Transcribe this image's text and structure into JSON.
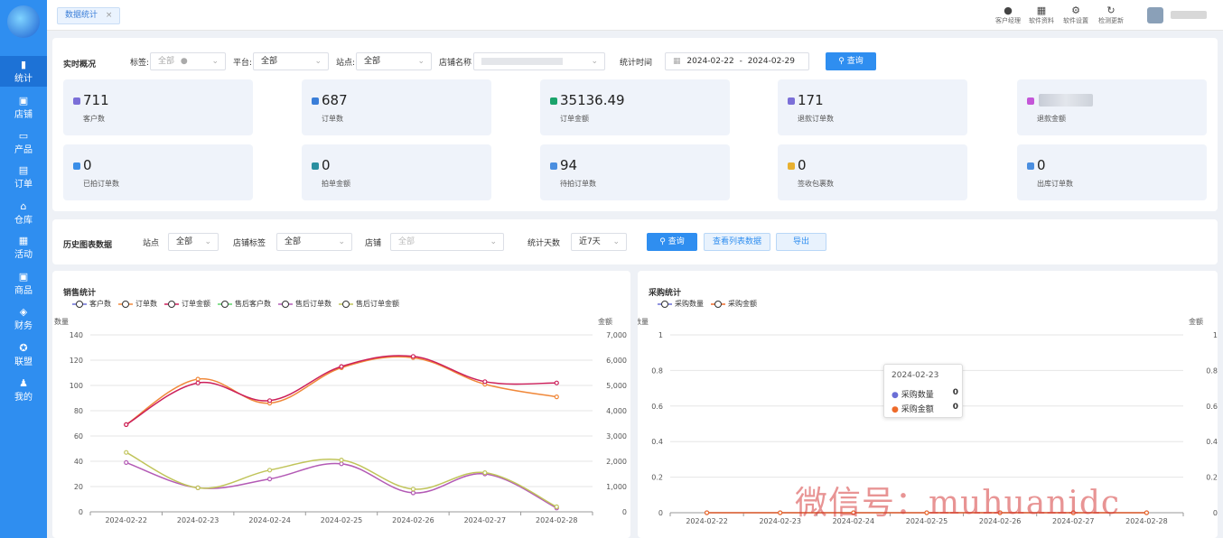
{
  "nav": [
    {
      "label": "统计",
      "icon": "bar-chart-icon",
      "active": true
    },
    {
      "label": "店铺",
      "icon": "store-icon"
    },
    {
      "label": "产品",
      "icon": "product-icon"
    },
    {
      "label": "订单",
      "icon": "order-icon"
    },
    {
      "label": "仓库",
      "icon": "warehouse-icon"
    },
    {
      "label": "活动",
      "icon": "gift-icon"
    },
    {
      "label": "商品",
      "icon": "goods-icon"
    },
    {
      "label": "财务",
      "icon": "finance-icon"
    },
    {
      "label": "联盟",
      "icon": "alliance-icon"
    },
    {
      "label": "我的",
      "icon": "user-icon"
    }
  ],
  "tab": {
    "label": "数据统计",
    "close": "×"
  },
  "topbar": {
    "buttons": [
      {
        "label": "客户经理",
        "icon": "manager-icon"
      },
      {
        "label": "软件资料",
        "icon": "docs-icon"
      },
      {
        "label": "软件设置",
        "icon": "gear-icon"
      },
      {
        "label": "检测更新",
        "icon": "refresh-icon"
      }
    ]
  },
  "realtime": {
    "title": "实时概况",
    "tag_label": "标签:",
    "tag_value": "全部",
    "platform_label": "平台:",
    "platform_value": "全部",
    "site_label": "站点:",
    "site_value": "全部",
    "shop_label": "店铺名称",
    "time_label": "统计时间",
    "date_start": "2024-02-22",
    "date_sep": "-",
    "date_end": "2024-02-29",
    "query": "查询"
  },
  "cards": [
    {
      "value": "711",
      "label": "客户数",
      "color": "#7b6fd8"
    },
    {
      "value": "687",
      "label": "订单数",
      "color": "#3a7ed8"
    },
    {
      "value": "35136.49",
      "label": "订单金额",
      "color": "#1aa36b"
    },
    {
      "value": "171",
      "label": "退款订单数",
      "color": "#7b6fd8"
    },
    {
      "value": "",
      "label": "退款金额",
      "color": "#c456d8"
    },
    {
      "value": "0",
      "label": "已拍订单数",
      "color": "#3a8ee8"
    },
    {
      "value": "0",
      "label": "拍单金额",
      "color": "#2a8fa0"
    },
    {
      "value": "94",
      "label": "待拍订单数",
      "color": "#4a8ee0"
    },
    {
      "value": "0",
      "label": "签收包裹数",
      "color": "#e8b030"
    },
    {
      "value": "0",
      "label": "出库订单数",
      "color": "#4a8ee0"
    }
  ],
  "history": {
    "title": "历史图表数据",
    "site_label": "站点",
    "site_value": "全部",
    "shoptag_label": "店铺标签",
    "shoptag_value": "全部",
    "shop_label": "店铺",
    "shop_value": "全部",
    "days_label": "统计天数",
    "days_value": "近7天",
    "query": "查询",
    "view_list": "查看列表数据",
    "export": "导出"
  },
  "chart_data": [
    {
      "type": "line",
      "title": "销售统计",
      "ylabel": "数量",
      "y2label": "金额",
      "ylim": [
        0,
        140
      ],
      "y2lim": [
        0,
        7000
      ],
      "yticks": [
        "0",
        "20",
        "40",
        "60",
        "80",
        "100",
        "120",
        "140"
      ],
      "y2ticks": [
        "0",
        "1,000",
        "2,000",
        "3,000",
        "4,000",
        "5,000",
        "6,000",
        "7,000"
      ],
      "categories": [
        "2024-02-22",
        "2024-02-23",
        "2024-02-24",
        "2024-02-25",
        "2024-02-26",
        "2024-02-27",
        "2024-02-28"
      ],
      "series": [
        {
          "name": "客户数",
          "color": "#6b6fd6",
          "values": [
            null,
            null,
            null,
            null,
            null,
            null,
            null
          ]
        },
        {
          "name": "订单数",
          "color": "#f0883a",
          "values": [
            69,
            105,
            86,
            114,
            122,
            101,
            91
          ]
        },
        {
          "name": "订单金额",
          "color": "#cc1f5a",
          "values": [
            69,
            102,
            88,
            115,
            123,
            103,
            102
          ]
        },
        {
          "name": "售后客户数",
          "color": "#5fd66a",
          "values": [
            null,
            null,
            null,
            null,
            null,
            null,
            null
          ]
        },
        {
          "name": "售后订单数",
          "color": "#b35ab5",
          "values": [
            39,
            19,
            26,
            38,
            15,
            30,
            3
          ]
        },
        {
          "name": "售后订单金额",
          "color": "#c0c45a",
          "values": [
            47,
            19,
            33,
            41,
            18,
            31,
            4
          ]
        }
      ],
      "grid": true,
      "legend": "top-left"
    },
    {
      "type": "line",
      "title": "采购统计",
      "ylabel": "数量",
      "y2label": "金额",
      "ylim": [
        0,
        1
      ],
      "y2lim": [
        0,
        1
      ],
      "yticks": [
        "0",
        "0.2",
        "0.4",
        "0.6",
        "0.8",
        "1"
      ],
      "y2ticks": [
        "0",
        "0.2",
        "0.4",
        "0.6",
        "0.8",
        "1"
      ],
      "categories": [
        "2024-02-22",
        "2024-02-23",
        "2024-02-24",
        "2024-02-25",
        "2024-02-26",
        "2024-02-27",
        "2024-02-28"
      ],
      "series": [
        {
          "name": "采购数量",
          "color": "#6b6fd6",
          "values": [
            0,
            0,
            0,
            0,
            0,
            0,
            0
          ]
        },
        {
          "name": "采购金额",
          "color": "#ee6a2a",
          "values": [
            0,
            0,
            0,
            0,
            0,
            0,
            0
          ]
        }
      ],
      "grid": true,
      "legend": "top-left"
    }
  ],
  "tooltip": {
    "date": "2024-02-23",
    "rows": [
      {
        "name": "采购数量",
        "value": "0",
        "color": "#6b6fd6"
      },
      {
        "name": "采购金额",
        "value": "0",
        "color": "#ee6a2a"
      }
    ]
  },
  "watermark": "微信号：muhuanidc"
}
